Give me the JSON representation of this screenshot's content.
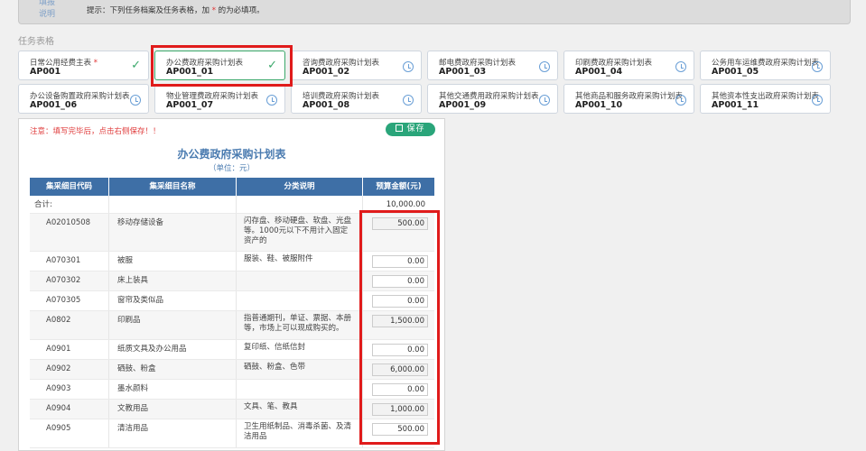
{
  "notice": {
    "label": "填报说明",
    "text_prefix": "提示：下列任务档案及任务表格，加",
    "text_required_mark": "*",
    "text_suffix": "的为必填项。"
  },
  "section_title": "任务表格",
  "cards": [
    {
      "name": "日常公用经费主表",
      "required": "*",
      "code": "AP001",
      "status": "done"
    },
    {
      "name": "办公费政府采购计划表",
      "required": "",
      "code": "AP001_01",
      "status": "done"
    },
    {
      "name": "咨询费政府采购计划表",
      "required": "",
      "code": "AP001_02",
      "status": "pending"
    },
    {
      "name": "邮电费政府采购计划表",
      "required": "",
      "code": "AP001_03",
      "status": "pending"
    },
    {
      "name": "印刷费政府采购计划表",
      "required": "",
      "code": "AP001_04",
      "status": "pending"
    },
    {
      "name": "公务用车运维费政府采购计划表",
      "required": "",
      "code": "AP001_05",
      "status": "pending"
    },
    {
      "name": "办公设备购置政府采购计划表",
      "required": "",
      "code": "AP001_06",
      "status": "pending"
    },
    {
      "name": "物业管理费政府采购计划表",
      "required": "",
      "code": "AP001_07",
      "status": "pending"
    },
    {
      "name": "培训费政府采购计划表",
      "required": "",
      "code": "AP001_08",
      "status": "pending"
    },
    {
      "name": "其他交通费用政府采购计划表",
      "required": "",
      "code": "AP001_09",
      "status": "pending"
    },
    {
      "name": "其他商品和服务政府采购计划表",
      "required": "",
      "code": "AP001_10",
      "status": "pending"
    },
    {
      "name": "其他资本性支出政府采购计划表",
      "required": "",
      "code": "AP001_11",
      "status": "pending"
    }
  ],
  "panel": {
    "warning": "注意：填写完毕后，点击右侧保存！！",
    "save_label": "保存",
    "title": "办公费政府采购计划表",
    "unit": "（单位：元）"
  },
  "table": {
    "headers": [
      "集采细目代码",
      "集采细目名称",
      "分类说明",
      "预算金额(元)"
    ],
    "total_label": "合计:",
    "total_value": "10,000.00",
    "rows": [
      {
        "code": "A02010508",
        "name": "移动存储设备",
        "desc": "闪存盘、移动硬盘、软盘、光盘等。1000元以下不用计入固定资产的",
        "amount": "500.00",
        "grey": true
      },
      {
        "code": "A070301",
        "name": "被服",
        "desc": "服装、鞋、被服附件",
        "amount": "0.00",
        "grey": false
      },
      {
        "code": "A070302",
        "name": "床上装具",
        "desc": "",
        "amount": "0.00",
        "grey": false
      },
      {
        "code": "A070305",
        "name": "窗帘及类似品",
        "desc": "",
        "amount": "0.00",
        "grey": false
      },
      {
        "code": "A0802",
        "name": "印刷品",
        "desc": "指普通期刊，单证、票据、本册等，市场上可以现成购买的。",
        "amount": "1,500.00",
        "grey": true
      },
      {
        "code": "A0901",
        "name": "纸质文具及办公用品",
        "desc": "复印纸、信纸信封",
        "amount": "0.00",
        "grey": false
      },
      {
        "code": "A0902",
        "name": "硒鼓、粉盒",
        "desc": "硒鼓、粉盒、色带",
        "amount": "6,000.00",
        "grey": true
      },
      {
        "code": "A0903",
        "name": "墨水颜料",
        "desc": "",
        "amount": "0.00",
        "grey": false
      },
      {
        "code": "A0904",
        "name": "文教用品",
        "desc": "文具、笔、教具",
        "amount": "1,000.00",
        "grey": true
      },
      {
        "code": "A0905",
        "name": "清洁用品",
        "desc": "卫生用纸制品、消毒杀菌、及清洁用品",
        "amount": "500.00",
        "grey": false
      }
    ]
  }
}
